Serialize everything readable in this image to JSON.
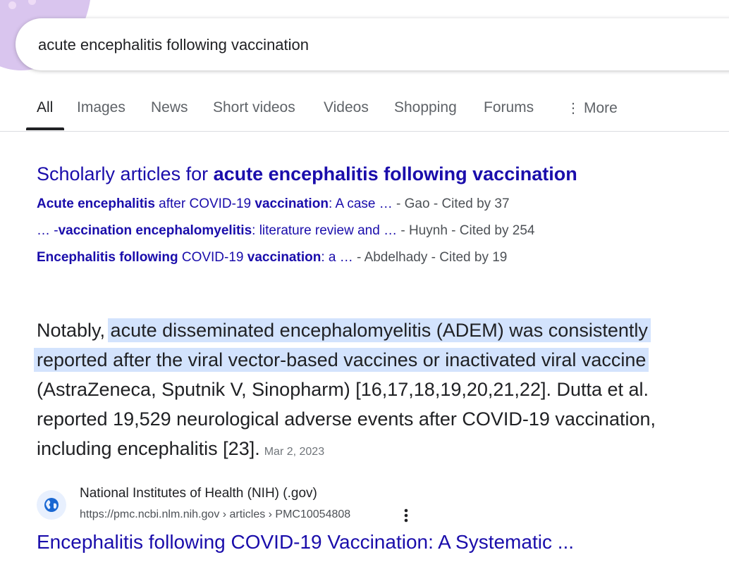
{
  "search": {
    "query": "acute encephalitis following vaccination"
  },
  "tabs": {
    "all": "All",
    "images": "Images",
    "news": "News",
    "short_videos": "Short videos",
    "videos": "Videos",
    "shopping": "Shopping",
    "forums": "Forums",
    "more": "More"
  },
  "scholar": {
    "heading_prefix": "Scholarly articles for ",
    "heading_query": "acute encephalitis following vaccination",
    "items": [
      {
        "parts": [
          {
            "t": "Acute encephalitis",
            "b": true
          },
          {
            "t": " after COVID-19 ",
            "b": false
          },
          {
            "t": "vaccination",
            "b": true
          },
          {
            "t": ": A case …",
            "b": false
          }
        ],
        "meta": " - Gao - Cited by 37"
      },
      {
        "parts": [
          {
            "t": "… -",
            "b": false
          },
          {
            "t": "vaccination encephalomyelitis",
            "b": true
          },
          {
            "t": ": literature review and …",
            "b": false
          }
        ],
        "meta": " - Huynh - Cited by 254"
      },
      {
        "parts": [
          {
            "t": "Encephalitis following",
            "b": true
          },
          {
            "t": " COVID-19 ",
            "b": false
          },
          {
            "t": "vaccination",
            "b": true
          },
          {
            "t": ": a …",
            "b": false
          }
        ],
        "meta": " - Abdelhady - Cited by 19"
      }
    ]
  },
  "snippet": {
    "prefix": "Notably, ",
    "highlight": "acute disseminated encephalomyelitis (ADEM) was consistently reported after the viral vector-based vaccines or inactivated viral vaccine",
    "suffix": " (AstraZeneca, Sputnik V, Sinopharm) [16,17,18,19,20,21,22]. Dutta et al. reported 19,529 neurological adverse events after COVID-19 vaccination, including encephalitis [23].",
    "date": "Mar 2, 2023"
  },
  "source": {
    "icon": "globe-icon",
    "name": "National Institutes of Health (NIH) (.gov)",
    "url": "https://pmc.ncbi.nlm.nih.gov › articles › PMC10054808",
    "title": "Encephalitis following COVID-19 Vaccination: A Systematic ..."
  },
  "colors": {
    "link": "#1a0dab",
    "highlight": "#d3e3fd",
    "muted": "#5f6368",
    "text": "#202124"
  }
}
